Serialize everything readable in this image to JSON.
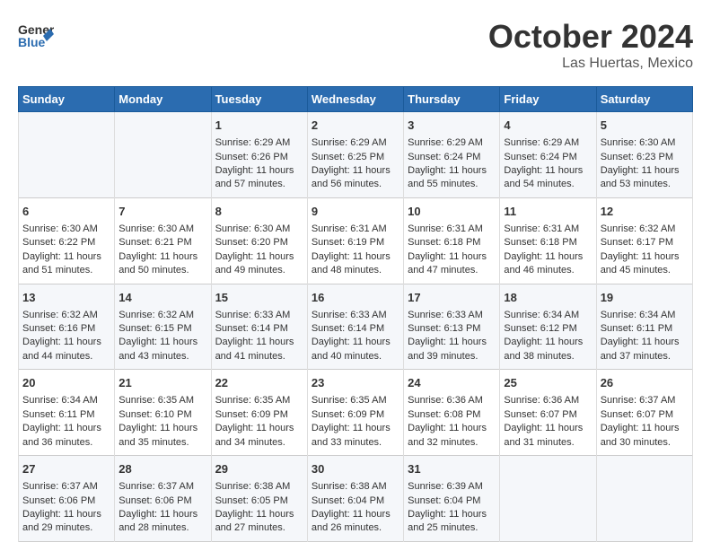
{
  "header": {
    "logo_general": "General",
    "logo_blue": "Blue",
    "month": "October 2024",
    "location": "Las Huertas, Mexico"
  },
  "days_of_week": [
    "Sunday",
    "Monday",
    "Tuesday",
    "Wednesday",
    "Thursday",
    "Friday",
    "Saturday"
  ],
  "weeks": [
    [
      {
        "day": "",
        "sunrise": "",
        "sunset": "",
        "daylight": ""
      },
      {
        "day": "",
        "sunrise": "",
        "sunset": "",
        "daylight": ""
      },
      {
        "day": "1",
        "sunrise": "Sunrise: 6:29 AM",
        "sunset": "Sunset: 6:26 PM",
        "daylight": "Daylight: 11 hours and 57 minutes."
      },
      {
        "day": "2",
        "sunrise": "Sunrise: 6:29 AM",
        "sunset": "Sunset: 6:25 PM",
        "daylight": "Daylight: 11 hours and 56 minutes."
      },
      {
        "day": "3",
        "sunrise": "Sunrise: 6:29 AM",
        "sunset": "Sunset: 6:24 PM",
        "daylight": "Daylight: 11 hours and 55 minutes."
      },
      {
        "day": "4",
        "sunrise": "Sunrise: 6:29 AM",
        "sunset": "Sunset: 6:24 PM",
        "daylight": "Daylight: 11 hours and 54 minutes."
      },
      {
        "day": "5",
        "sunrise": "Sunrise: 6:30 AM",
        "sunset": "Sunset: 6:23 PM",
        "daylight": "Daylight: 11 hours and 53 minutes."
      }
    ],
    [
      {
        "day": "6",
        "sunrise": "Sunrise: 6:30 AM",
        "sunset": "Sunset: 6:22 PM",
        "daylight": "Daylight: 11 hours and 51 minutes."
      },
      {
        "day": "7",
        "sunrise": "Sunrise: 6:30 AM",
        "sunset": "Sunset: 6:21 PM",
        "daylight": "Daylight: 11 hours and 50 minutes."
      },
      {
        "day": "8",
        "sunrise": "Sunrise: 6:30 AM",
        "sunset": "Sunset: 6:20 PM",
        "daylight": "Daylight: 11 hours and 49 minutes."
      },
      {
        "day": "9",
        "sunrise": "Sunrise: 6:31 AM",
        "sunset": "Sunset: 6:19 PM",
        "daylight": "Daylight: 11 hours and 48 minutes."
      },
      {
        "day": "10",
        "sunrise": "Sunrise: 6:31 AM",
        "sunset": "Sunset: 6:18 PM",
        "daylight": "Daylight: 11 hours and 47 minutes."
      },
      {
        "day": "11",
        "sunrise": "Sunrise: 6:31 AM",
        "sunset": "Sunset: 6:18 PM",
        "daylight": "Daylight: 11 hours and 46 minutes."
      },
      {
        "day": "12",
        "sunrise": "Sunrise: 6:32 AM",
        "sunset": "Sunset: 6:17 PM",
        "daylight": "Daylight: 11 hours and 45 minutes."
      }
    ],
    [
      {
        "day": "13",
        "sunrise": "Sunrise: 6:32 AM",
        "sunset": "Sunset: 6:16 PM",
        "daylight": "Daylight: 11 hours and 44 minutes."
      },
      {
        "day": "14",
        "sunrise": "Sunrise: 6:32 AM",
        "sunset": "Sunset: 6:15 PM",
        "daylight": "Daylight: 11 hours and 43 minutes."
      },
      {
        "day": "15",
        "sunrise": "Sunrise: 6:33 AM",
        "sunset": "Sunset: 6:14 PM",
        "daylight": "Daylight: 11 hours and 41 minutes."
      },
      {
        "day": "16",
        "sunrise": "Sunrise: 6:33 AM",
        "sunset": "Sunset: 6:14 PM",
        "daylight": "Daylight: 11 hours and 40 minutes."
      },
      {
        "day": "17",
        "sunrise": "Sunrise: 6:33 AM",
        "sunset": "Sunset: 6:13 PM",
        "daylight": "Daylight: 11 hours and 39 minutes."
      },
      {
        "day": "18",
        "sunrise": "Sunrise: 6:34 AM",
        "sunset": "Sunset: 6:12 PM",
        "daylight": "Daylight: 11 hours and 38 minutes."
      },
      {
        "day": "19",
        "sunrise": "Sunrise: 6:34 AM",
        "sunset": "Sunset: 6:11 PM",
        "daylight": "Daylight: 11 hours and 37 minutes."
      }
    ],
    [
      {
        "day": "20",
        "sunrise": "Sunrise: 6:34 AM",
        "sunset": "Sunset: 6:11 PM",
        "daylight": "Daylight: 11 hours and 36 minutes."
      },
      {
        "day": "21",
        "sunrise": "Sunrise: 6:35 AM",
        "sunset": "Sunset: 6:10 PM",
        "daylight": "Daylight: 11 hours and 35 minutes."
      },
      {
        "day": "22",
        "sunrise": "Sunrise: 6:35 AM",
        "sunset": "Sunset: 6:09 PM",
        "daylight": "Daylight: 11 hours and 34 minutes."
      },
      {
        "day": "23",
        "sunrise": "Sunrise: 6:35 AM",
        "sunset": "Sunset: 6:09 PM",
        "daylight": "Daylight: 11 hours and 33 minutes."
      },
      {
        "day": "24",
        "sunrise": "Sunrise: 6:36 AM",
        "sunset": "Sunset: 6:08 PM",
        "daylight": "Daylight: 11 hours and 32 minutes."
      },
      {
        "day": "25",
        "sunrise": "Sunrise: 6:36 AM",
        "sunset": "Sunset: 6:07 PM",
        "daylight": "Daylight: 11 hours and 31 minutes."
      },
      {
        "day": "26",
        "sunrise": "Sunrise: 6:37 AM",
        "sunset": "Sunset: 6:07 PM",
        "daylight": "Daylight: 11 hours and 30 minutes."
      }
    ],
    [
      {
        "day": "27",
        "sunrise": "Sunrise: 6:37 AM",
        "sunset": "Sunset: 6:06 PM",
        "daylight": "Daylight: 11 hours and 29 minutes."
      },
      {
        "day": "28",
        "sunrise": "Sunrise: 6:37 AM",
        "sunset": "Sunset: 6:06 PM",
        "daylight": "Daylight: 11 hours and 28 minutes."
      },
      {
        "day": "29",
        "sunrise": "Sunrise: 6:38 AM",
        "sunset": "Sunset: 6:05 PM",
        "daylight": "Daylight: 11 hours and 27 minutes."
      },
      {
        "day": "30",
        "sunrise": "Sunrise: 6:38 AM",
        "sunset": "Sunset: 6:04 PM",
        "daylight": "Daylight: 11 hours and 26 minutes."
      },
      {
        "day": "31",
        "sunrise": "Sunrise: 6:39 AM",
        "sunset": "Sunset: 6:04 PM",
        "daylight": "Daylight: 11 hours and 25 minutes."
      },
      {
        "day": "",
        "sunrise": "",
        "sunset": "",
        "daylight": ""
      },
      {
        "day": "",
        "sunrise": "",
        "sunset": "",
        "daylight": ""
      }
    ]
  ]
}
